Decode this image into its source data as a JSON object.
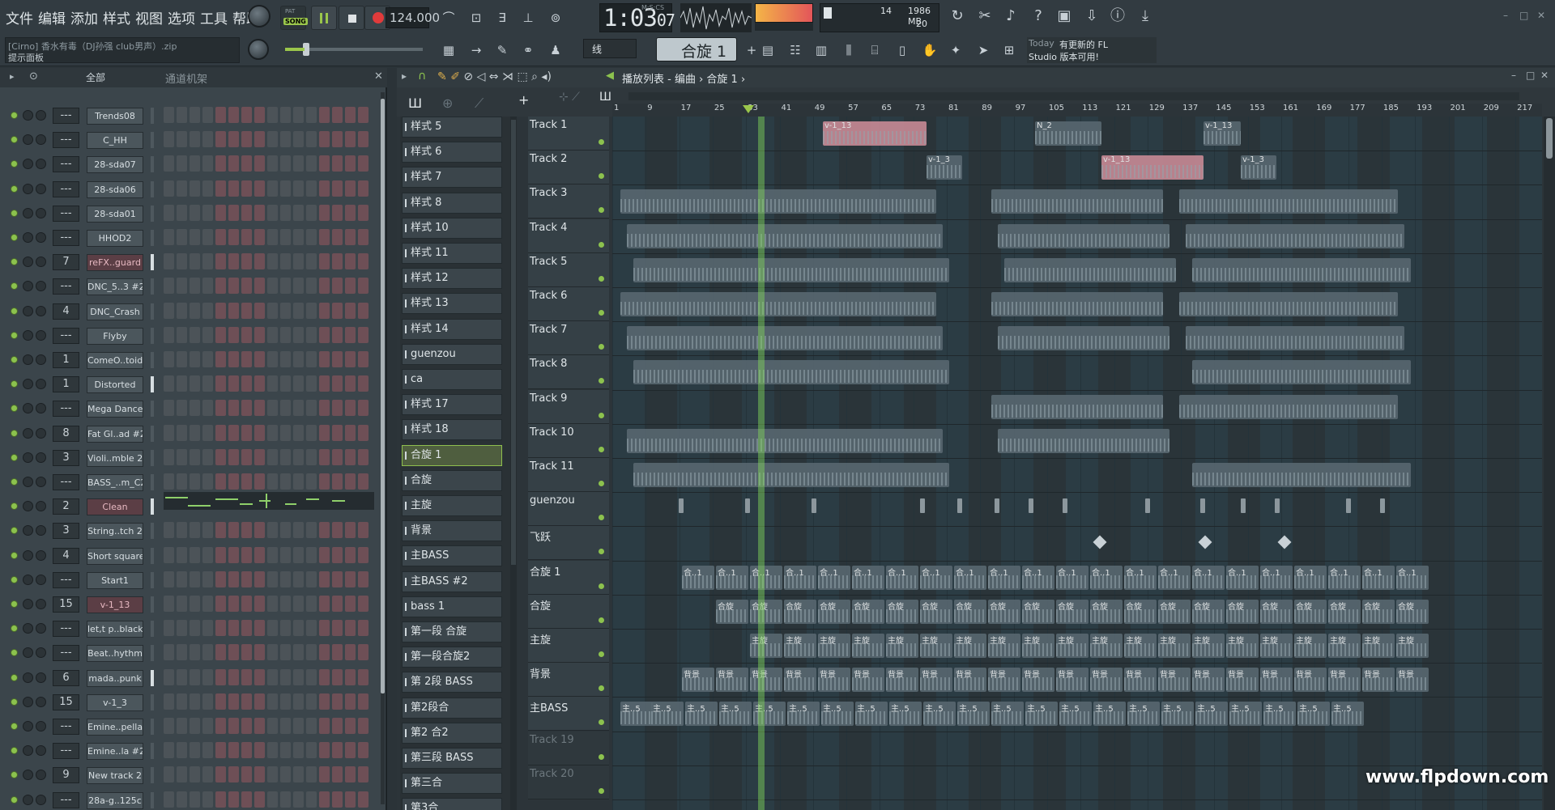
{
  "menu": [
    "文件",
    "编辑",
    "添加",
    "样式",
    "视图",
    "选项",
    "工具",
    "帮助"
  ],
  "hint": {
    "file": "[Cirno] 香水有毒（DJ孙强 club男声）.zip",
    "panel": "提示面板"
  },
  "transport": {
    "song": "SONG",
    "pat": "PAT",
    "tempo": "124.000",
    "time": "1:03",
    "time_sub": "07",
    "time_unit": "M:S:CS"
  },
  "cpu": {
    "cpu": "14",
    "mem": "1986 MB",
    "voices": "20"
  },
  "snap": "线",
  "pattern_selector": "合旋 1",
  "news": {
    "day": "Today",
    "text": "有更新的 FL",
    "text2": "Studio 版本可用!"
  },
  "rack": {
    "filter": "全部",
    "title": "通道机架",
    "channels": [
      {
        "num": "---",
        "name": "Trends08"
      },
      {
        "num": "---",
        "name": "C_HH"
      },
      {
        "num": "---",
        "name": "28-sda07"
      },
      {
        "num": "---",
        "name": "28-sda06"
      },
      {
        "num": "---",
        "name": "28-sda01"
      },
      {
        "num": "---",
        "name": "HHOD2"
      },
      {
        "num": "7",
        "name": "reFX..guard",
        "hl": true
      },
      {
        "num": "---",
        "name": "DNC_5..3 #2"
      },
      {
        "num": "4",
        "name": "DNC_Crash"
      },
      {
        "num": "---",
        "name": "Flyby"
      },
      {
        "num": "1",
        "name": "ComeO..toid"
      },
      {
        "num": "1",
        "name": "Distorted"
      },
      {
        "num": "---",
        "name": "Mega Dance"
      },
      {
        "num": "8",
        "name": "Fat Gl..ad #2"
      },
      {
        "num": "3",
        "name": "Violi..mble 2"
      },
      {
        "num": "---",
        "name": "BASS_..m_C2"
      },
      {
        "num": "2",
        "name": "Clean",
        "hl": true
      },
      {
        "num": "3",
        "name": "String..tch 2"
      },
      {
        "num": "4",
        "name": "Short square"
      },
      {
        "num": "---",
        "name": "Start1"
      },
      {
        "num": "15",
        "name": "v-1_13",
        "hl": true
      },
      {
        "num": "---",
        "name": "let,t p..black"
      },
      {
        "num": "---",
        "name": "Beat..hythm"
      },
      {
        "num": "6",
        "name": "mada..punk"
      },
      {
        "num": "15",
        "name": "v-1_3"
      },
      {
        "num": "---",
        "name": "Emine..pella"
      },
      {
        "num": "---",
        "name": "Emine..la #2"
      },
      {
        "num": "9",
        "name": "New track 2"
      },
      {
        "num": "---",
        "name": "28a-g..125c"
      }
    ]
  },
  "playlist": {
    "title": "播放列表 - 编曲 › 合旋 1 ›",
    "patterns": [
      "样式 5",
      "样式 6",
      "样式 7",
      "样式 8",
      "样式 10",
      "样式 11",
      "样式 12",
      "样式 13",
      "样式 14",
      "guenzou",
      "ca",
      "样式 17",
      "样式 18",
      "合旋 1",
      "合旋",
      "主旋",
      "背景",
      "主BASS",
      "主BASS #2",
      "bass 1",
      "第一段 合旋",
      "第一段合旋2",
      "第 2段 BASS",
      "第2段合",
      "第2 合2",
      "第三段 BASS",
      "第三合",
      "第3合"
    ],
    "selected_pattern": "合旋 1",
    "tracks": [
      {
        "name": "Track 1"
      },
      {
        "name": "Track 2"
      },
      {
        "name": "Track 3"
      },
      {
        "name": "Track 4"
      },
      {
        "name": "Track 5"
      },
      {
        "name": "Track 6"
      },
      {
        "name": "Track 7"
      },
      {
        "name": "Track 8"
      },
      {
        "name": "Track 9"
      },
      {
        "name": "Track 10"
      },
      {
        "name": "Track 11"
      },
      {
        "name": "guenzou"
      },
      {
        "name": "飞跃"
      },
      {
        "name": "合旋 1"
      },
      {
        "name": "合旋"
      },
      {
        "name": "主旋"
      },
      {
        "name": "背景"
      },
      {
        "name": "主BASS"
      },
      {
        "name": "Track 19",
        "dim": true
      },
      {
        "name": "Track 20",
        "dim": true
      }
    ],
    "ticks": [
      "1",
      "9",
      "17",
      "25",
      "33",
      "41",
      "49",
      "57",
      "65",
      "73",
      "81",
      "89",
      "97",
      "105",
      "113",
      "121",
      "129",
      "137",
      "145",
      "153",
      "161",
      "169",
      "177",
      "185",
      "193",
      "201",
      "209",
      "217"
    ]
  },
  "clip_labels": {
    "v13": "v-1_13",
    "v3": "v-1_3",
    "n2": "N_2",
    "he": "合..1",
    "hx": "合旋",
    "zx": "主旋",
    "bj": "背景",
    "zb": "主..5"
  },
  "watermark": "www.flpdown.com"
}
